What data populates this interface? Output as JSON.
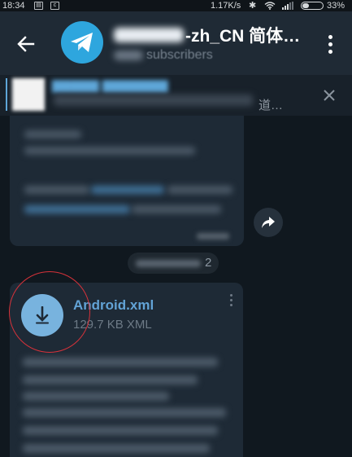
{
  "status_bar": {
    "time": "18:34",
    "network_speed": "1.17K/s",
    "battery_percent": "33%",
    "battery_level": 0.33,
    "icons": [
      "gallery-icon",
      "app-icon",
      "bluetooth-icon",
      "wifi-icon",
      "signal-icon",
      "battery-icon"
    ]
  },
  "header": {
    "back_icon": "arrow-left-icon",
    "channel_title_visible": "-zh_CN 简体…",
    "subscriber_text_visible": "subscribers",
    "menu_icon": "more-vertical-icon",
    "avatar_color": "#2ea6de"
  },
  "pinned": {
    "tail_text": "道…",
    "close_icon": "close-icon",
    "accent_color": "#5ea6d8"
  },
  "chat": {
    "share_icon": "share-arrow-icon",
    "date_chip_visible": "2",
    "file": {
      "name": "Android.xml",
      "meta": "129.7 KB XML",
      "download_icon": "download-arrow-icon",
      "name_color": "#62a3d6"
    },
    "annotation_color": "#d6323a"
  }
}
